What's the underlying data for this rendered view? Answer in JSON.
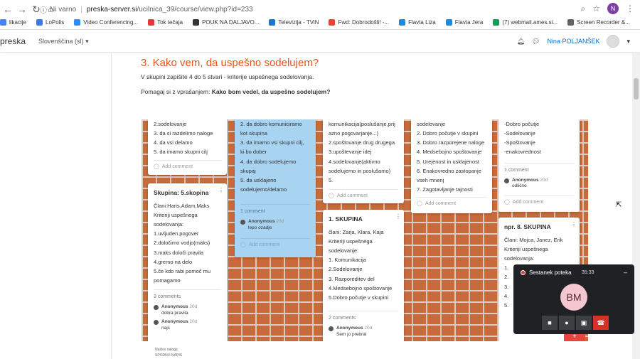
{
  "browser": {
    "security_label": "Ni varno",
    "host": "preska-server.si",
    "path": "/ucilnica_39/course/view.php?id=233",
    "profile_initial": "N"
  },
  "bookmarks": [
    {
      "label": "likacije",
      "color": "#4285f4"
    },
    {
      "label": "LoPolis",
      "color": "#3b78e7"
    },
    {
      "label": "Video Conferencing...",
      "color": "#2d8cff"
    },
    {
      "label": "Tok tečaja",
      "color": "#e53935"
    },
    {
      "label": "POUK NA DALJAVO...",
      "color": "#333333"
    },
    {
      "label": "Televizija - TViN",
      "color": "#1976d2"
    },
    {
      "label": "Fwd: Dobrodošli! -...",
      "color": "#ea4335"
    },
    {
      "label": "Flavta Liza",
      "color": "#1e88e5"
    },
    {
      "label": "Flavta Jera",
      "color": "#1e88e5"
    },
    {
      "label": "(7) webmail.ames.si...",
      "color": "#0f9d58"
    },
    {
      "label": "Screen Recorder &...",
      "color": "#5f6368"
    }
  ],
  "moodle": {
    "brand": "preska",
    "language": "Slovenščina (sl)",
    "user": "Nina POLJANŠEK"
  },
  "section": {
    "heading": "3. Kako vem, da uspešno sodelujem?",
    "instruction": "V skupini zapišite 4 do 5 stvari - kriterije uspešnega sodelovanja.",
    "help_prefix": "Pomagaj si z vprašanjem: ",
    "help_question": "Kako bom vedel, da uspešno sodelujem?"
  },
  "cards": {
    "c1": {
      "lines": [
        "2.sodelovanje",
        "3. da si razdelimo naloge",
        "4. da vsi delamo",
        "5. da imamo skupni cilj"
      ],
      "add_comment": "Add comment"
    },
    "c2": {
      "title": "Skupina: 5.skopina",
      "lines": [
        "Člani:Haris,Adam,Maks",
        "Kriteriji uspešnega",
        "sodelovanja:",
        "1.uvljuden pogover",
        "2.določimo vodjo(maks)",
        "3.maks določi pravila",
        "4.gremo na delo",
        "5.če kdo rabi pomoč mu",
        "pomagamo"
      ],
      "comment_count": "3 comments",
      "comments": [
        {
          "user": "Anonymous",
          "time": "20d",
          "text": "dobra pravila"
        },
        {
          "user": "Anonymous",
          "time": "20d",
          "text": "najs"
        }
      ]
    },
    "c3": {
      "lines": [
        "2. da dobro komuniciramo",
        "kot skupina",
        "3. da imamo vsi skupni cilj,",
        "ki bo dober",
        "4. da dobro sodelujemo",
        "skupaj",
        "5. da usklajeno",
        "sodelujemo/delamo"
      ],
      "comment_count": "1 comment",
      "comments": [
        {
          "user": "Anonymous",
          "time": "20d",
          "text": "lepo ozadje"
        }
      ],
      "add_comment": "Add comment"
    },
    "c4": {
      "lines": [
        "komunikacija(poslušanje,prij",
        "azno pogovarjanje...)",
        "2.spoštovanje drug drugega",
        "3.upoštevanje idej",
        "4.sodelovanje(aktivno",
        "sodelujemo in poslušamo)",
        "5."
      ],
      "add_comment": "Add comment"
    },
    "c5": {
      "title": "1. SKUPINA",
      "lines": [
        "člani: Zarja, Klara, Kaja",
        "Kriteriji uspešnega",
        "sodelovanje:",
        "1. Komunikacija",
        "2.Sodelovanje",
        "3. Razporeditev del",
        "4.Medsebojno spoštovanje",
        "5.Dobro počutje v skupini"
      ],
      "comment_count": "2 comments",
      "comments": [
        {
          "user": "Anonymous",
          "time": "20d",
          "text": "Sem jo prebral"
        }
      ]
    },
    "c6": {
      "lines": [
        "sodelovanje",
        "2. Dobro počutje v skupini",
        "3. Dobro razporejene naloge",
        "4. Medsebojno spoštovanje",
        "5. Urejenost in usklajenost",
        "6. Enakovredno zastopanje",
        "vseh mnenj",
        "7. Zagotavljanje tajnosti"
      ],
      "add_comment": "Add comment"
    },
    "c7": {
      "lines": [
        "-Dobro počutje",
        "-Sodelovanje",
        "-Spoštovanje",
        "-enakovrednost"
      ],
      "comment_count": "1 comment",
      "comments": [
        {
          "user": "Anonymous",
          "time": "20d",
          "text": "odlično"
        }
      ],
      "add_comment": "Add comment"
    },
    "c8": {
      "title": "npr. 8. SKUPINA",
      "lines": [
        "Člani: Mojca, Janez, Erik",
        "Kriteriji uspešnega",
        "sodelovanja:",
        "1.",
        "2.",
        "3.",
        "4.",
        "5."
      ]
    }
  },
  "meet": {
    "status": "Sestanek poteka",
    "time": "35:33",
    "initials": "BM"
  },
  "bottom": {
    "line1": "Naslov naloga",
    "line2": "SPODNJI NAPIS"
  }
}
